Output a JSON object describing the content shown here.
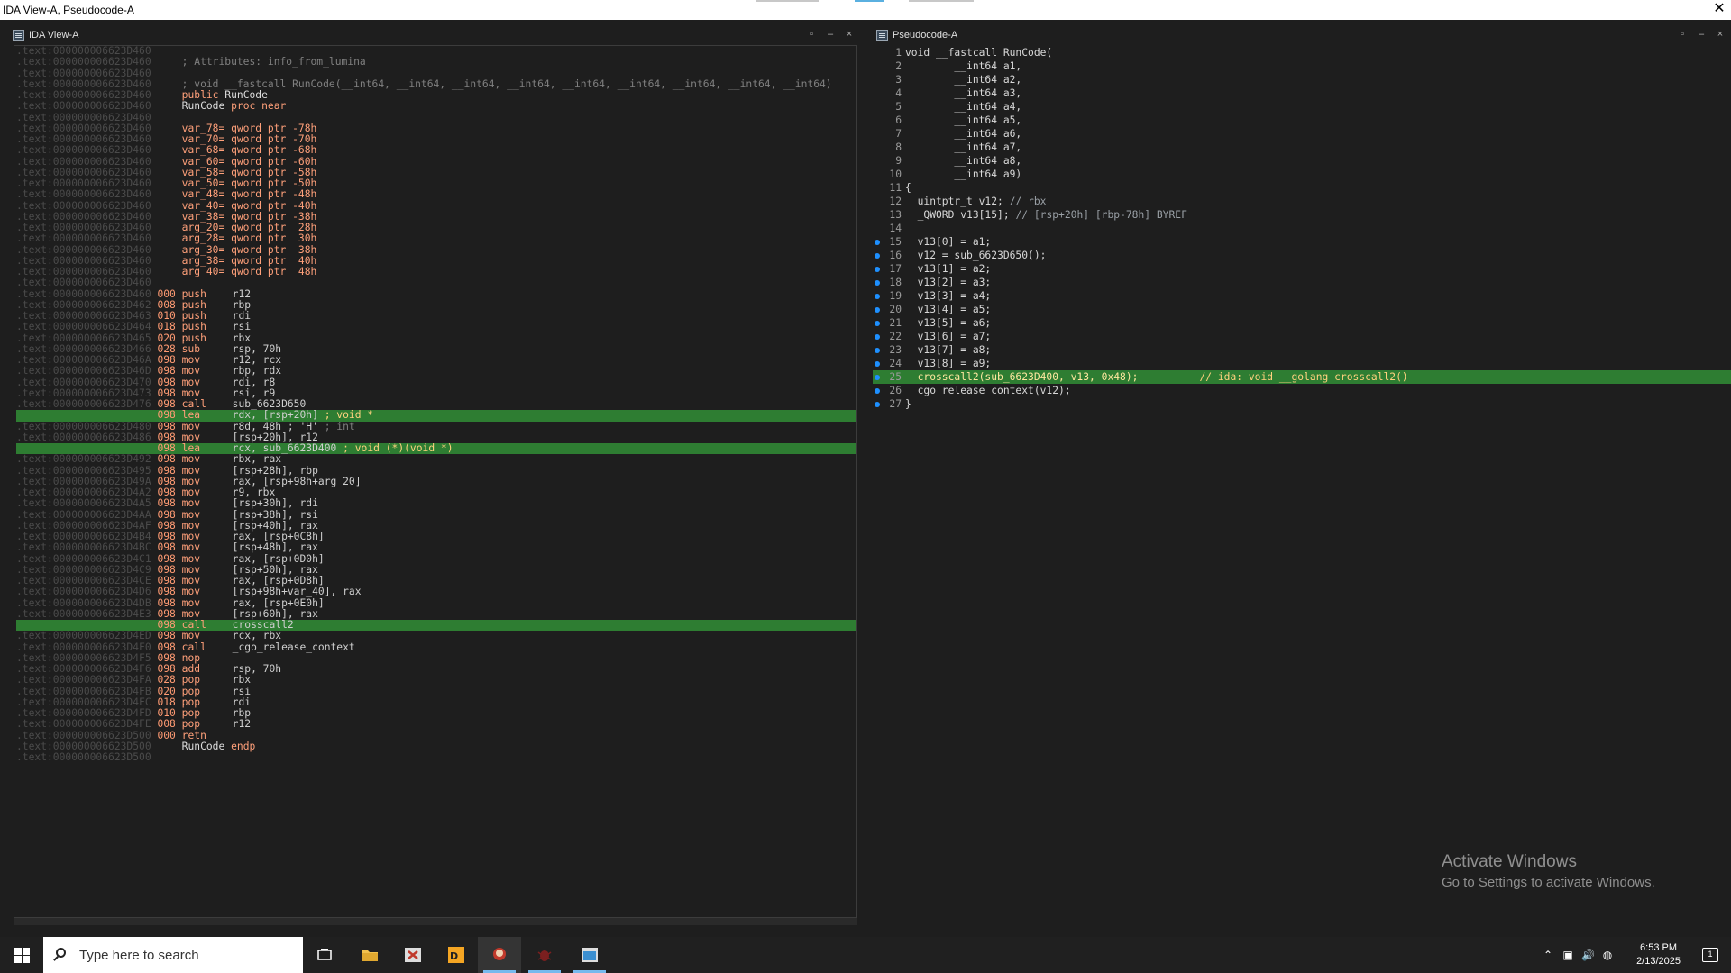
{
  "window": {
    "title": "IDA View-A, Pseudocode-A",
    "close_label": "✕"
  },
  "ida_view": {
    "title": "IDA View-A",
    "buttons": {
      "restore": "▫",
      "minimize": "–",
      "close": "×"
    },
    "lines": [
      {
        "addr": ".text:000000006623D460",
        "sp": "",
        "mn": "",
        "op": "",
        "cm": ""
      },
      {
        "addr": ".text:000000006623D460",
        "sp": "",
        "mn": "",
        "op": "",
        "cm": "; Attributes: info_from_lumina"
      },
      {
        "addr": ".text:000000006623D460",
        "sp": "",
        "mn": "",
        "op": "",
        "cm": ""
      },
      {
        "addr": ".text:000000006623D460",
        "sp": "",
        "mn": "",
        "op": "",
        "cm": "; void __fastcall RunCode(__int64, __int64, __int64, __int64, __int64, __int64, __int64, __int64, __int64)"
      },
      {
        "addr": ".text:000000006623D460",
        "sp": "",
        "mn": "",
        "op": "",
        "cm": "",
        "kw": "public",
        "name": "RunCode"
      },
      {
        "addr": ".text:000000006623D460",
        "sp": "",
        "mn": "",
        "op": "",
        "cm": "",
        "name2": "RunCode",
        "kw2": "proc near"
      },
      {
        "addr": ".text:000000006623D460",
        "sp": "",
        "mn": "",
        "op": "",
        "cm": ""
      },
      {
        "addr": ".text:000000006623D460",
        "var": "var_78= qword ptr -78h"
      },
      {
        "addr": ".text:000000006623D460",
        "var": "var_70= qword ptr -70h"
      },
      {
        "addr": ".text:000000006623D460",
        "var": "var_68= qword ptr -68h"
      },
      {
        "addr": ".text:000000006623D460",
        "var": "var_60= qword ptr -60h"
      },
      {
        "addr": ".text:000000006623D460",
        "var": "var_58= qword ptr -58h"
      },
      {
        "addr": ".text:000000006623D460",
        "var": "var_50= qword ptr -50h"
      },
      {
        "addr": ".text:000000006623D460",
        "var": "var_48= qword ptr -48h"
      },
      {
        "addr": ".text:000000006623D460",
        "var": "var_40= qword ptr -40h"
      },
      {
        "addr": ".text:000000006623D460",
        "var": "var_38= qword ptr -38h"
      },
      {
        "addr": ".text:000000006623D460",
        "var": "arg_20= qword ptr  28h"
      },
      {
        "addr": ".text:000000006623D460",
        "var": "arg_28= qword ptr  30h"
      },
      {
        "addr": ".text:000000006623D460",
        "var": "arg_30= qword ptr  38h"
      },
      {
        "addr": ".text:000000006623D460",
        "var": "arg_38= qword ptr  40h"
      },
      {
        "addr": ".text:000000006623D460",
        "var": "arg_40= qword ptr  48h"
      },
      {
        "addr": ".text:000000006623D460",
        "sp": "",
        "mn": "",
        "op": "",
        "cm": ""
      },
      {
        "addr": ".text:000000006623D460",
        "sp": "000",
        "mn": "push",
        "op": "r12"
      },
      {
        "addr": ".text:000000006623D462",
        "sp": "008",
        "mn": "push",
        "op": "rbp"
      },
      {
        "addr": ".text:000000006623D463",
        "sp": "010",
        "mn": "push",
        "op": "rdi"
      },
      {
        "addr": ".text:000000006623D464",
        "sp": "018",
        "mn": "push",
        "op": "rsi"
      },
      {
        "addr": ".text:000000006623D465",
        "sp": "020",
        "mn": "push",
        "op": "rbx"
      },
      {
        "addr": ".text:000000006623D466",
        "sp": "028",
        "mn": "sub",
        "op": "rsp, 70h"
      },
      {
        "addr": ".text:000000006623D46A",
        "sp": "098",
        "mn": "mov",
        "op": "r12, rcx"
      },
      {
        "addr": ".text:000000006623D46D",
        "sp": "098",
        "mn": "mov",
        "op": "rbp, rdx"
      },
      {
        "addr": ".text:000000006623D470",
        "sp": "098",
        "mn": "mov",
        "op": "rdi, r8"
      },
      {
        "addr": ".text:000000006623D473",
        "sp": "098",
        "mn": "mov",
        "op": "rsi, r9"
      },
      {
        "addr": ".text:000000006623D476",
        "sp": "098",
        "mn": "call",
        "op": "sub_6623D650"
      },
      {
        "addr": ".text:000000006623D47B",
        "sp": "098",
        "mn": "lea",
        "op": "rdx, [rsp+20h]",
        "cm": "; void *",
        "hl": true
      },
      {
        "addr": ".text:000000006623D480",
        "sp": "098",
        "mn": "mov",
        "op": "r8d, 48h ; 'H'",
        "cm": "; int"
      },
      {
        "addr": ".text:000000006623D486",
        "sp": "098",
        "mn": "mov",
        "op": "[rsp+20h], r12"
      },
      {
        "addr": ".text:000000006623D48B",
        "sp": "098",
        "mn": "lea",
        "op": "rcx, sub_6623D400",
        "cm": "; void (*)(void *)",
        "hl": true
      },
      {
        "addr": ".text:000000006623D492",
        "sp": "098",
        "mn": "mov",
        "op": "rbx, rax"
      },
      {
        "addr": ".text:000000006623D495",
        "sp": "098",
        "mn": "mov",
        "op": "[rsp+28h], rbp"
      },
      {
        "addr": ".text:000000006623D49A",
        "sp": "098",
        "mn": "mov",
        "op": "rax, [rsp+98h+arg_20]"
      },
      {
        "addr": ".text:000000006623D4A2",
        "sp": "098",
        "mn": "mov",
        "op": "r9, rbx"
      },
      {
        "addr": ".text:000000006623D4A5",
        "sp": "098",
        "mn": "mov",
        "op": "[rsp+30h], rdi"
      },
      {
        "addr": ".text:000000006623D4AA",
        "sp": "098",
        "mn": "mov",
        "op": "[rsp+38h], rsi"
      },
      {
        "addr": ".text:000000006623D4AF",
        "sp": "098",
        "mn": "mov",
        "op": "[rsp+40h], rax"
      },
      {
        "addr": ".text:000000006623D4B4",
        "sp": "098",
        "mn": "mov",
        "op": "rax, [rsp+0C8h]"
      },
      {
        "addr": ".text:000000006623D4BC",
        "sp": "098",
        "mn": "mov",
        "op": "[rsp+48h], rax"
      },
      {
        "addr": ".text:000000006623D4C1",
        "sp": "098",
        "mn": "mov",
        "op": "rax, [rsp+0D0h]"
      },
      {
        "addr": ".text:000000006623D4C9",
        "sp": "098",
        "mn": "mov",
        "op": "[rsp+50h], rax"
      },
      {
        "addr": ".text:000000006623D4CE",
        "sp": "098",
        "mn": "mov",
        "op": "rax, [rsp+0D8h]"
      },
      {
        "addr": ".text:000000006623D4D6",
        "sp": "098",
        "mn": "mov",
        "op": "[rsp+98h+var_40], rax"
      },
      {
        "addr": ".text:000000006623D4DB",
        "sp": "098",
        "mn": "mov",
        "op": "rax, [rsp+0E0h]"
      },
      {
        "addr": ".text:000000006623D4E3",
        "sp": "098",
        "mn": "mov",
        "op": "[rsp+60h], rax"
      },
      {
        "addr": ".text:000000006623D4E8",
        "sp": "098",
        "mn": "call",
        "op": "crosscall2",
        "hl": true
      },
      {
        "addr": ".text:000000006623D4ED",
        "sp": "098",
        "mn": "mov",
        "op": "rcx, rbx"
      },
      {
        "addr": ".text:000000006623D4F0",
        "sp": "098",
        "mn": "call",
        "op": "_cgo_release_context"
      },
      {
        "addr": ".text:000000006623D4F5",
        "sp": "098",
        "mn": "nop",
        "op": ""
      },
      {
        "addr": ".text:000000006623D4F6",
        "sp": "098",
        "mn": "add",
        "op": "rsp, 70h"
      },
      {
        "addr": ".text:000000006623D4FA",
        "sp": "028",
        "mn": "pop",
        "op": "rbx"
      },
      {
        "addr": ".text:000000006623D4FB",
        "sp": "020",
        "mn": "pop",
        "op": "rsi"
      },
      {
        "addr": ".text:000000006623D4FC",
        "sp": "018",
        "mn": "pop",
        "op": "rdi"
      },
      {
        "addr": ".text:000000006623D4FD",
        "sp": "010",
        "mn": "pop",
        "op": "rbp"
      },
      {
        "addr": ".text:000000006623D4FE",
        "sp": "008",
        "mn": "pop",
        "op": "r12"
      },
      {
        "addr": ".text:000000006623D500",
        "sp": "000",
        "mn": "retn",
        "op": ""
      },
      {
        "addr": ".text:000000006623D500",
        "sp": "",
        "mn": "",
        "op": "",
        "cm": "",
        "name2": "RunCode",
        "kw2": "endp"
      },
      {
        "addr": ".text:000000006623D500",
        "sp": "",
        "mn": "",
        "op": "",
        "cm": ""
      }
    ]
  },
  "pseudo_view": {
    "title": "Pseudocode-A",
    "buttons": {
      "restore": "▫",
      "minimize": "–",
      "close": "×"
    },
    "lines": [
      {
        "n": "1",
        "dot": false,
        "t": "void __fastcall RunCode("
      },
      {
        "n": "2",
        "dot": false,
        "t": "        __int64 a1,"
      },
      {
        "n": "3",
        "dot": false,
        "t": "        __int64 a2,"
      },
      {
        "n": "4",
        "dot": false,
        "t": "        __int64 a3,"
      },
      {
        "n": "5",
        "dot": false,
        "t": "        __int64 a4,"
      },
      {
        "n": "6",
        "dot": false,
        "t": "        __int64 a5,"
      },
      {
        "n": "7",
        "dot": false,
        "t": "        __int64 a6,"
      },
      {
        "n": "8",
        "dot": false,
        "t": "        __int64 a7,"
      },
      {
        "n": "9",
        "dot": false,
        "t": "        __int64 a8,"
      },
      {
        "n": "10",
        "dot": false,
        "t": "        __int64 a9)"
      },
      {
        "n": "11",
        "dot": false,
        "t": "{"
      },
      {
        "n": "12",
        "dot": false,
        "t": "  uintptr_t v12; ",
        "c": "// rbx"
      },
      {
        "n": "13",
        "dot": false,
        "t": "  _QWORD v13[15]; ",
        "c": "// [rsp+20h] [rbp-78h] BYREF"
      },
      {
        "n": "14",
        "dot": false,
        "t": ""
      },
      {
        "n": "15",
        "dot": true,
        "t": "  v13[0] = a1;"
      },
      {
        "n": "16",
        "dot": true,
        "t": "  v12 = sub_6623D650();"
      },
      {
        "n": "17",
        "dot": true,
        "t": "  v13[1] = a2;"
      },
      {
        "n": "18",
        "dot": true,
        "t": "  v13[2] = a3;"
      },
      {
        "n": "19",
        "dot": true,
        "t": "  v13[3] = a4;"
      },
      {
        "n": "20",
        "dot": true,
        "t": "  v13[4] = a5;"
      },
      {
        "n": "21",
        "dot": true,
        "t": "  v13[5] = a6;"
      },
      {
        "n": "22",
        "dot": true,
        "t": "  v13[6] = a7;"
      },
      {
        "n": "23",
        "dot": true,
        "t": "  v13[7] = a8;"
      },
      {
        "n": "24",
        "dot": true,
        "t": "  v13[8] = a9;"
      },
      {
        "n": "25",
        "dot": true,
        "t": "  crosscall2(sub_6623D400, v13, 0x48);",
        "c": "          // ida: void __golang crosscall2()",
        "hl": true
      },
      {
        "n": "26",
        "dot": true,
        "t": "  cgo_release_context(v12);"
      },
      {
        "n": "27",
        "dot": true,
        "t": "}"
      }
    ]
  },
  "watermark": {
    "line1": "Activate Windows",
    "line2": "Go to Settings to activate Windows."
  },
  "taskbar": {
    "search_placeholder": "Type here to search",
    "clock_time": "6:53 PM",
    "clock_date": "2/13/2025",
    "notif_count": "1"
  },
  "colors": {
    "highlight": "#2e7d32",
    "accent": "#76b9ed"
  }
}
